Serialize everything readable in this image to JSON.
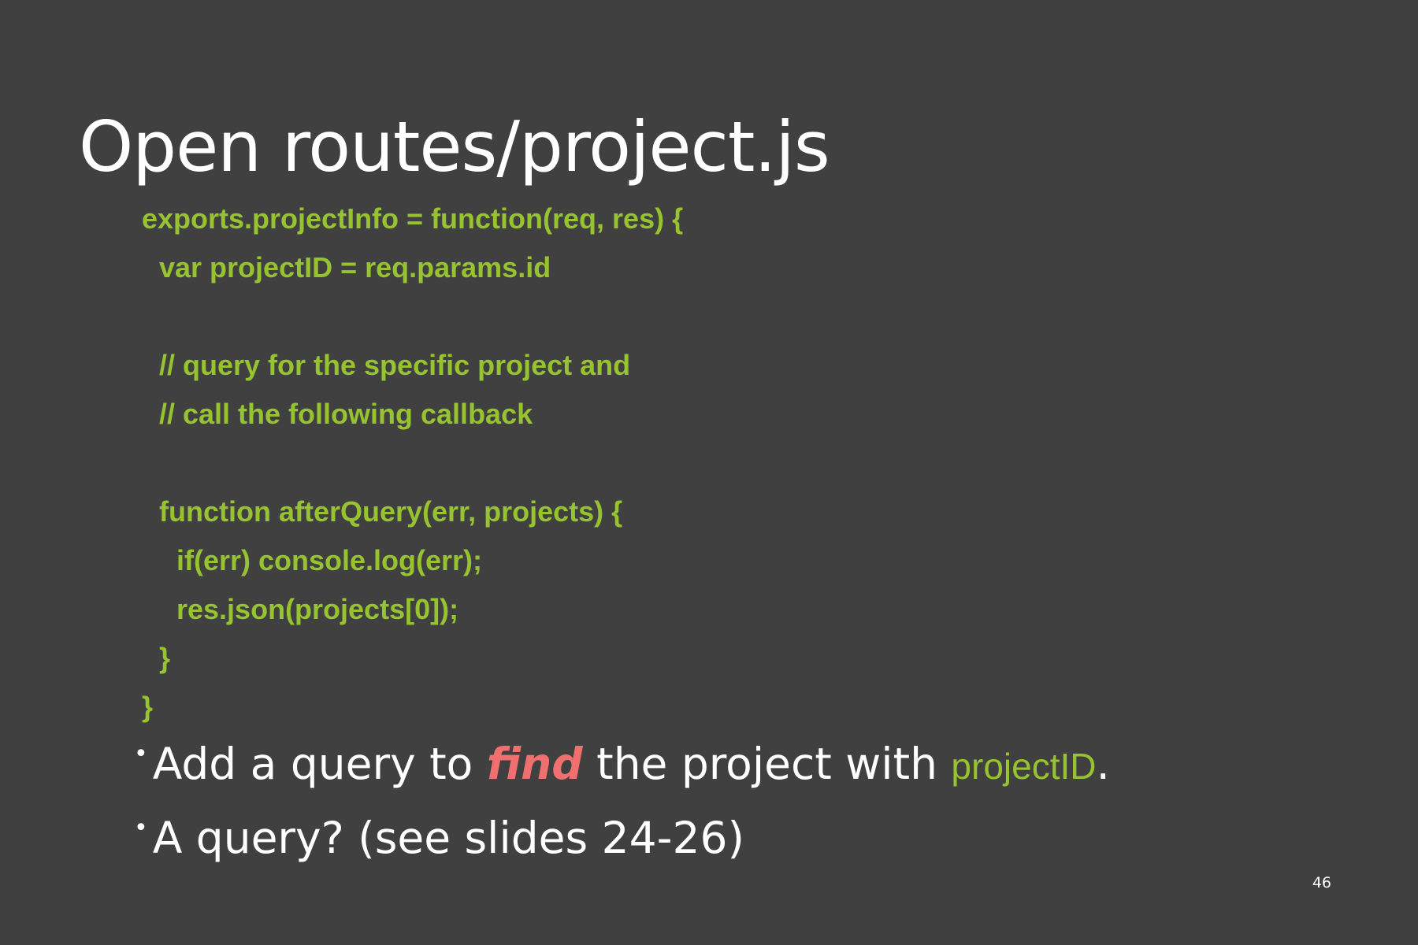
{
  "slide": {
    "title": "Open routes/project.js",
    "code_lines": [
      "exports.projectInfo = function(req, res) {",
      "var projectID = req.params.id",
      "// query for the specific project and",
      "// call the following callback",
      "function afterQuery(err, projects) {",
      "if(err) console.log(err);",
      "res.json(projects[0]);",
      "}",
      "}"
    ],
    "bullets": [
      {
        "marker": "•",
        "before": "Add a query to ",
        "emphasis": "find",
        "middle": " the project with ",
        "code": "projectID",
        "after": "."
      },
      {
        "marker": "•",
        "text": "A query? (see slides 24-26)"
      }
    ],
    "page_number": "46"
  },
  "colors": {
    "background": "#404040",
    "code": "#97c331",
    "emphasis": "#f07070",
    "text": "#ffffff"
  }
}
